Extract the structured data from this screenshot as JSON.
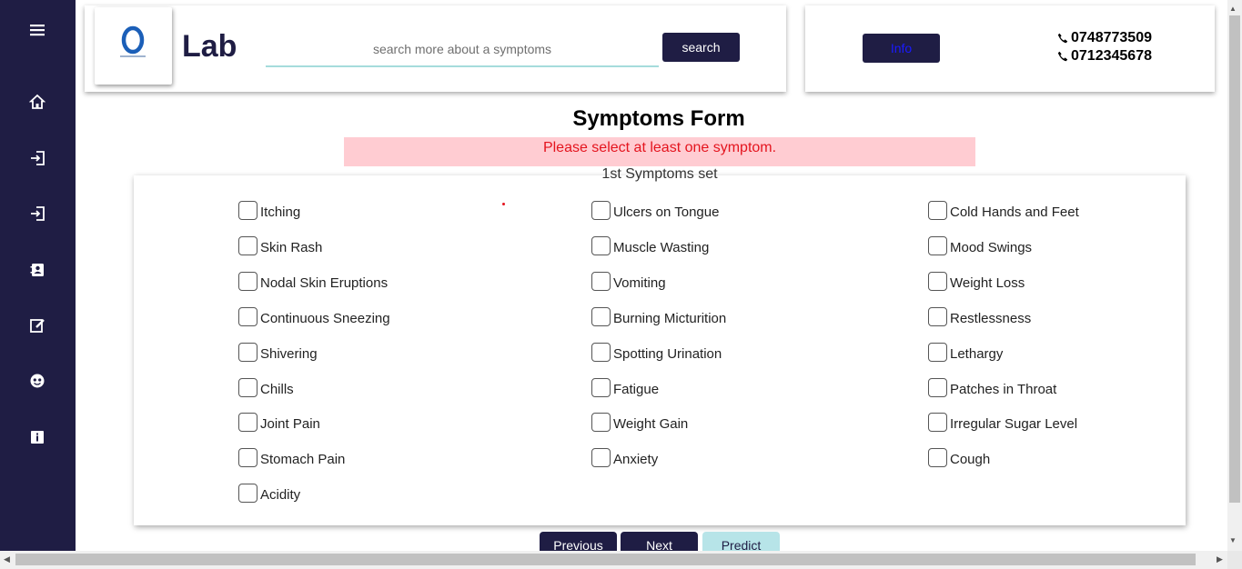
{
  "header": {
    "brand": "Lab",
    "search_placeholder": "search more about a symptoms",
    "search_button": "search",
    "info_button": "Info",
    "phones": [
      "0748773509",
      "0712345678"
    ]
  },
  "sidebar": {
    "items": [
      "menu-icon",
      "home-icon",
      "login-icon",
      "signup-icon",
      "contacts-icon",
      "edit-icon",
      "face-icon",
      "info-icon"
    ]
  },
  "form": {
    "title": "Symptoms Form",
    "alert": "Please select at least one symptom.",
    "set_label": "1st Symptoms set",
    "columns": [
      [
        "Itching",
        "Skin Rash",
        "Nodal Skin Eruptions",
        "Continuous Sneezing",
        "Shivering",
        "Chills",
        "Joint Pain",
        "Stomach Pain",
        "Acidity"
      ],
      [
        "Ulcers on Tongue",
        "Muscle Wasting",
        "Vomiting",
        "Burning Micturition",
        "Spotting Urination",
        "Fatigue",
        "Weight Gain",
        "Anxiety"
      ],
      [
        "Cold Hands and Feet",
        "Mood Swings",
        "Weight Loss",
        "Restlessness",
        "Lethargy",
        "Patches in Throat",
        "Irregular Sugar Level",
        "Cough"
      ]
    ]
  },
  "nav": {
    "previous": "Previous",
    "next": "Next",
    "predict": "Predict"
  },
  "colors": {
    "sidebar": "#1f1d44",
    "alert_bg": "#ffccd2",
    "alert_text": "#e4141e",
    "predict_bg": "#b7e4e8"
  }
}
